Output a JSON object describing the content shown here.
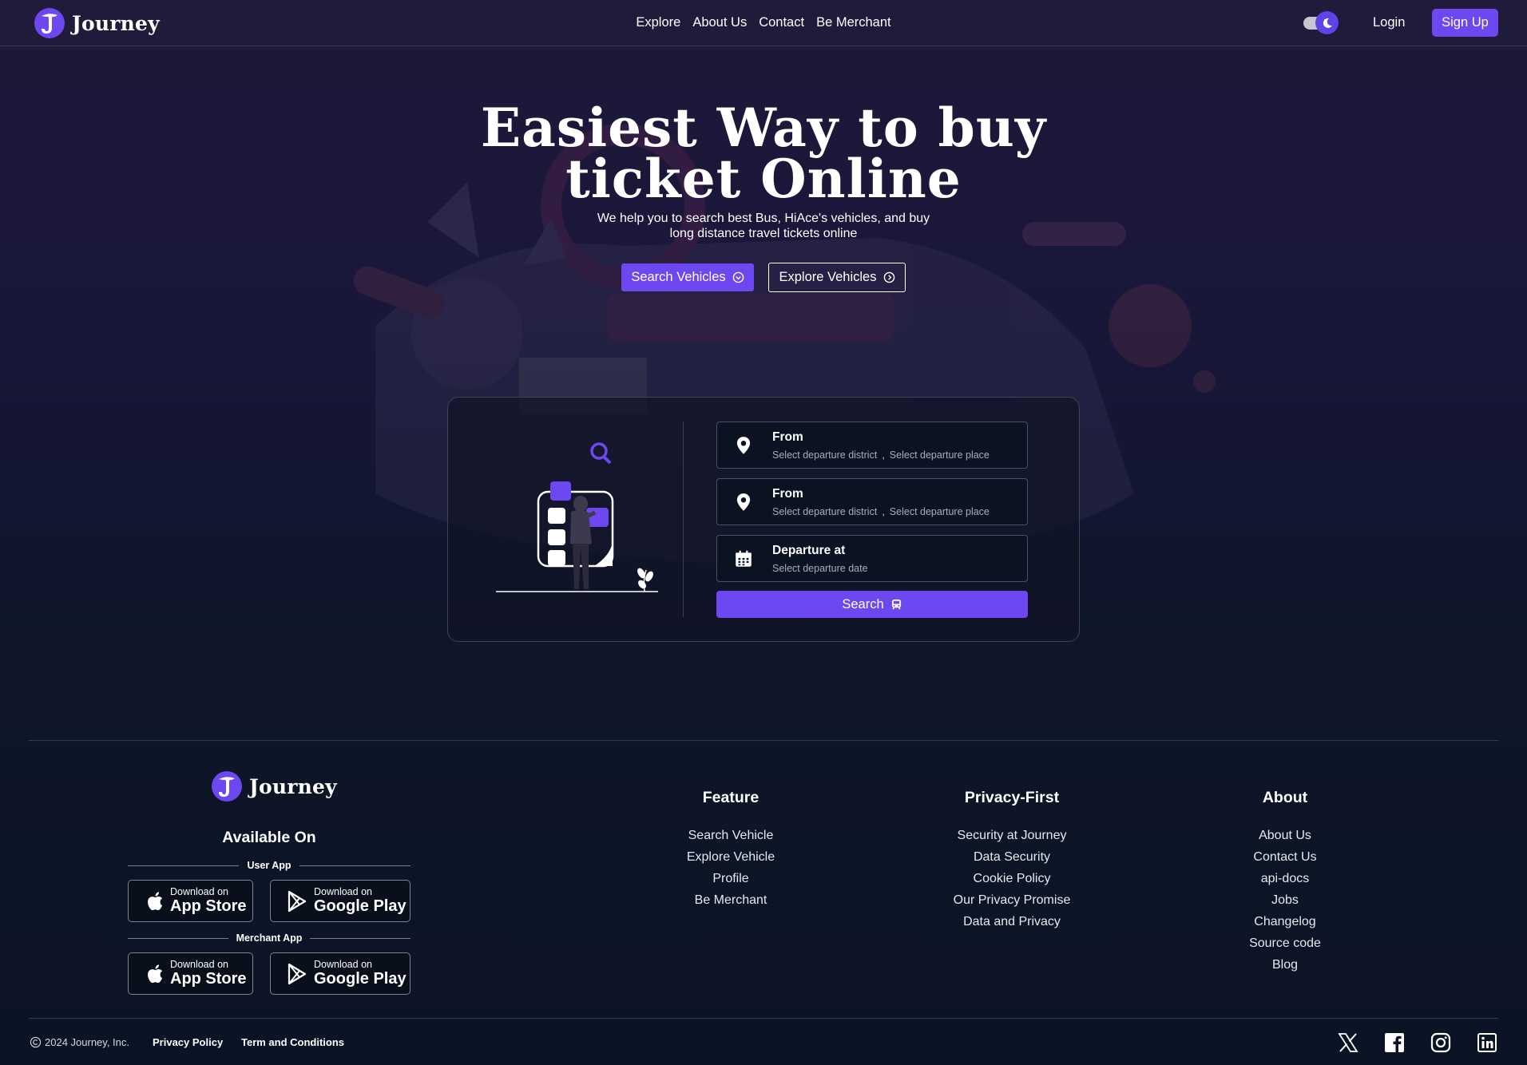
{
  "nav": {
    "brand": "Journey",
    "links": [
      "Explore",
      "About Us",
      "Contact",
      "Be Merchant"
    ],
    "login": "Login",
    "signup": "Sign Up"
  },
  "hero": {
    "title_line1": "Easiest Way to buy",
    "title_line2": "ticket Online",
    "subtitle_line1": "We help you to search best Bus, HiAce's vehicles, and buy",
    "subtitle_line2": "long distance travel tickets online",
    "search_button": "Search Vehicles",
    "explore_button": "Explore Vehicles"
  },
  "search_form": {
    "from1": {
      "label": "From",
      "district": "Select departure district",
      "place": "Select departure place"
    },
    "from2": {
      "label": "From",
      "district": "Select departure district",
      "place": "Select departure place"
    },
    "departure": {
      "label": "Departure at",
      "hint": "Select departure date"
    },
    "separator": ",",
    "submit": "Search"
  },
  "footer": {
    "brand": "Journey",
    "available_on": "Available On",
    "user_app": "User App",
    "merchant_app": "Merchant App",
    "download_on": "Download on",
    "app_store": "App Store",
    "google_play": "Google Play",
    "columns": [
      {
        "title": "Feature",
        "links": [
          "Search Vehicle",
          "Explore Vehicle",
          "Profile",
          "Be Merchant"
        ]
      },
      {
        "title": "Privacy-First",
        "links": [
          "Security at Journey",
          "Data Security",
          "Cookie Policy",
          "Our Privacy Promise",
          "Data and Privacy"
        ]
      },
      {
        "title": "About",
        "links": [
          "About Us",
          "Contact Us",
          "api-docs",
          "Jobs",
          "Changelog",
          "Source code",
          "Blog"
        ]
      }
    ],
    "copyright": "2024 Journey, Inc.",
    "privacy_policy": "Privacy Policy",
    "terms": "Term and Conditions"
  },
  "icons": {
    "social": [
      "x-icon",
      "facebook-icon",
      "instagram-icon",
      "linkedin-icon"
    ]
  },
  "colors": {
    "accent": "#6d48f0",
    "nav_bg": "#201a3b",
    "page_bottom": "#0b1424"
  }
}
